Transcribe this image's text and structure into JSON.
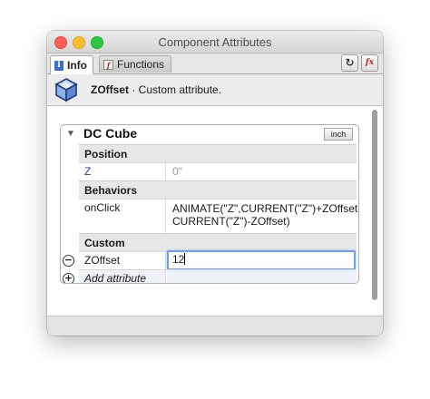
{
  "window": {
    "title": "Component Attributes"
  },
  "tabs": [
    {
      "label": "Info",
      "icon": "info-icon",
      "active": true
    },
    {
      "label": "Functions",
      "icon": "function-icon",
      "active": false
    }
  ],
  "toolbar": {
    "refresh_icon": "refresh-icon",
    "fx_icon": "fx-icon",
    "fx_label": "fx"
  },
  "header": {
    "attribute_name": "ZOffset",
    "separator": " · ",
    "description": "Custom attribute."
  },
  "component": {
    "name": "DC Cube",
    "units": "inch"
  },
  "sections": {
    "position": {
      "label": "Position",
      "rows": [
        {
          "name": "Z",
          "value": "0\""
        }
      ]
    },
    "behaviors": {
      "label": "Behaviors",
      "rows": [
        {
          "name": "onClick",
          "value_line1": "ANIMATE(\"Z\",CURRENT(\"Z\")+ZOffset,",
          "value_line2": "CURRENT(\"Z\")-ZOffset)"
        }
      ]
    },
    "custom": {
      "label": "Custom",
      "rows": [
        {
          "name": "ZOffset",
          "value": "12"
        }
      ],
      "add_label": "Add attribute"
    }
  },
  "colors": {
    "accent": "#6ea0e8",
    "attribute_name": "#1c3e9a",
    "formula_value": "#9a9a9a"
  }
}
